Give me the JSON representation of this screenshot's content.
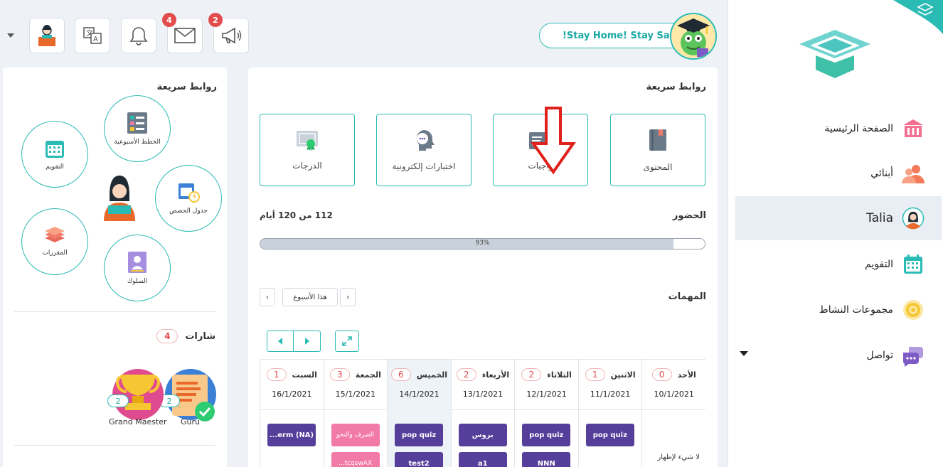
{
  "sidebar": {
    "items": [
      {
        "label": "الصفحة الرئيسية",
        "icon": "school-icon"
      },
      {
        "label": "أبنائي",
        "icon": "children-icon"
      },
      {
        "label": "Talia",
        "icon": "avatar-icon"
      },
      {
        "label": "التقويم",
        "icon": "calendar-icon"
      },
      {
        "label": "مجموعات النشاط",
        "icon": "activity-icon"
      },
      {
        "label": "تواصل",
        "icon": "chat-icon"
      }
    ]
  },
  "topbar": {
    "announcements_badge": "2",
    "messages_badge": "4",
    "stay_home": "!Stay Home! Stay Safe"
  },
  "left_panel": {
    "title": "روابط سريعة",
    "links": [
      "الخطط الأسبوعية",
      "التقويم",
      "جدول الحصص",
      "المقررات",
      "السلوك"
    ],
    "badges_title": "شارات",
    "badges_count": "4",
    "awards": [
      {
        "label": "Guru",
        "count": "2"
      },
      {
        "label": "Grand Maester",
        "count": "2"
      }
    ]
  },
  "main": {
    "title": "روابط سريعة",
    "cards": [
      "المحتوى",
      "واجبات",
      "اختبارات إلكترونية",
      "الدرجات"
    ],
    "attendance_title": "الحضور",
    "attendance_value": "112 من 120 أيام",
    "attendance_percent": 93,
    "attendance_percent_label": "93%",
    "tasks_title": "المهمات",
    "this_week": "هذا الأسبوع",
    "days": [
      {
        "name": "الأحد",
        "count": "0",
        "date": "10/1/2021",
        "tasks": [],
        "empty": "لا شيء لإظهار"
      },
      {
        "name": "الاثنين",
        "count": "1",
        "date": "11/1/2021",
        "tasks": [
          {
            "text": "pop quiz",
            "pink": false
          }
        ]
      },
      {
        "name": "الثلاثاء",
        "count": "2",
        "date": "12/1/2021",
        "tasks": [
          {
            "text": "pop quiz",
            "pink": false
          },
          {
            "text": "NNN",
            "pink": false
          }
        ]
      },
      {
        "name": "الأربعاء",
        "count": "2",
        "date": "13/1/2021",
        "tasks": [
          {
            "text": "بروس",
            "pink": false
          },
          {
            "text": "a1",
            "pink": false
          }
        ]
      },
      {
        "name": "الخميس",
        "count": "6",
        "date": "14/1/2021",
        "tasks": [
          {
            "text": "pop quiz",
            "pink": false
          },
          {
            "text": "test2",
            "pink": false
          }
        ],
        "today": true
      },
      {
        "name": "الجمعة",
        "count": "3",
        "date": "15/1/2021",
        "tasks": [
          {
            "text": "الصرف والنحو",
            "pink": true
          },
          {
            "text": "...tcqswAX",
            "pink": true
          }
        ]
      },
      {
        "name": "السبت",
        "count": "1",
        "date": "16/1/2021",
        "tasks": [
          {
            "text": "...erm (NA)",
            "pink": false
          }
        ]
      }
    ]
  },
  "colors": {
    "teal": "#2bbbb5",
    "purple": "#553f9a",
    "pink": "#f27aa6",
    "red": "#e34c4c"
  }
}
